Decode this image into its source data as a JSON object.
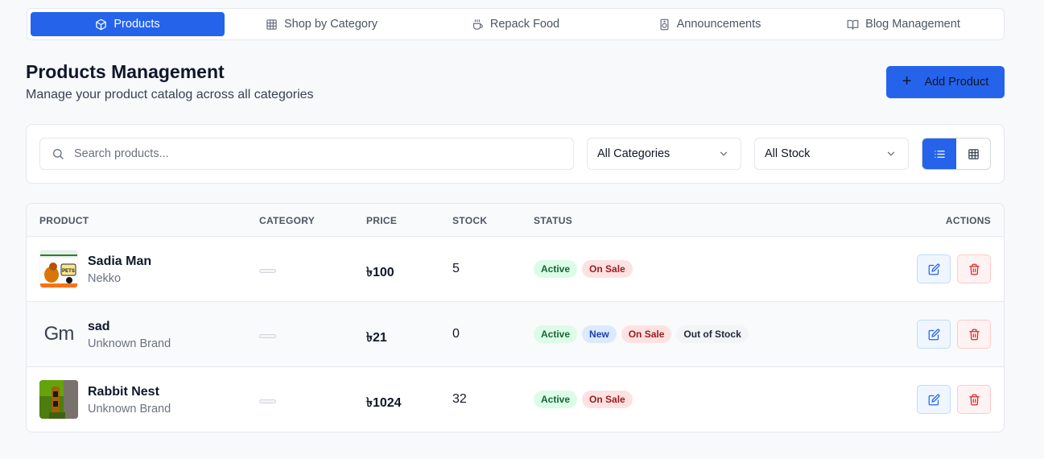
{
  "tabs": [
    {
      "label": "Products",
      "icon": "package-icon",
      "active": true
    },
    {
      "label": "Shop by Category",
      "icon": "grid-icon",
      "active": false
    },
    {
      "label": "Repack Food",
      "icon": "coffee-icon",
      "active": false
    },
    {
      "label": "Announcements",
      "icon": "speaker-icon",
      "active": false
    },
    {
      "label": "Blog Management",
      "icon": "book-icon",
      "active": false
    }
  ],
  "header": {
    "title": "Products Management",
    "subtitle": "Manage your product catalog across all categories",
    "add_label": "Add Product"
  },
  "filters": {
    "search_placeholder": "Search products...",
    "category_value": "All Categories",
    "stock_value": "All Stock",
    "view_mode": "list"
  },
  "table": {
    "columns": {
      "product": "PRODUCT",
      "category": "CATEGORY",
      "price": "PRICE",
      "stock": "STOCK",
      "status": "STATUS",
      "actions": "ACTIONS"
    },
    "rows": [
      {
        "name": "Sadia Man",
        "brand": "Nekko",
        "price": "৳100",
        "stock": "5",
        "image_label": "PETS",
        "badges": [
          {
            "label": "Active",
            "kind": "active"
          },
          {
            "label": "On Sale",
            "kind": "sale"
          }
        ]
      },
      {
        "name": "sad",
        "brand": "Unknown Brand",
        "price": "৳21",
        "stock": "0",
        "image_label": "Gm",
        "badges": [
          {
            "label": "Active",
            "kind": "active"
          },
          {
            "label": "New",
            "kind": "new"
          },
          {
            "label": "On Sale",
            "kind": "sale"
          },
          {
            "label": "Out of Stock",
            "kind": "oos"
          }
        ]
      },
      {
        "name": "Rabbit Nest",
        "brand": "Unknown Brand",
        "price": "৳1024",
        "stock": "32",
        "image_label": "",
        "badges": [
          {
            "label": "Active",
            "kind": "active"
          },
          {
            "label": "On Sale",
            "kind": "sale"
          }
        ]
      }
    ]
  },
  "colors": {
    "accent": "#2563eb",
    "active_badge": "#dcfce7",
    "sale_badge": "#fee2e2",
    "new_badge": "#dbeafe"
  }
}
